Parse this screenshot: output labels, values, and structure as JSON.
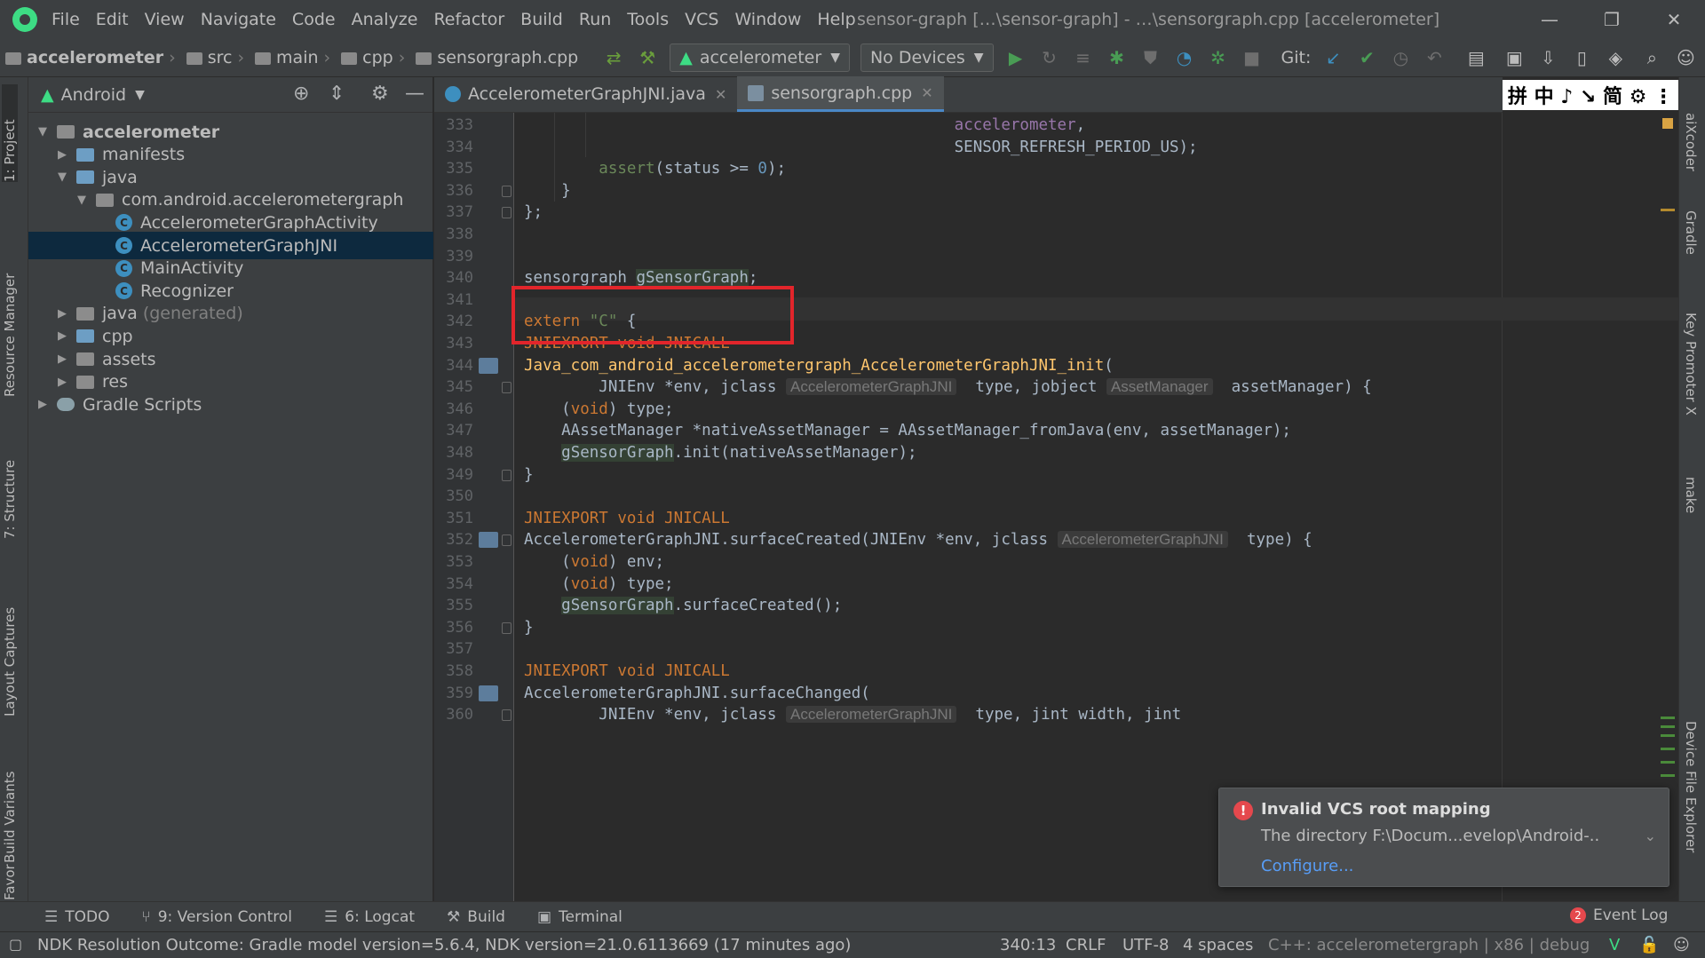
{
  "menubar": {
    "items": [
      "File",
      "Edit",
      "View",
      "Navigate",
      "Code",
      "Analyze",
      "Refactor",
      "Build",
      "Run",
      "Tools",
      "VCS",
      "Window",
      "Help"
    ],
    "title": "sensor-graph […\\sensor-graph] - …\\sensorgraph.cpp [accelerometer]"
  },
  "breadcrumbs": [
    "accelerometer",
    "src",
    "main",
    "cpp",
    "sensorgraph.cpp"
  ],
  "toolbar": {
    "run_config": "accelerometer",
    "device": "No Devices",
    "git_label": "Git:"
  },
  "project": {
    "view_mode": "Android",
    "tree": [
      {
        "label": "accelerometer",
        "depth": 0,
        "expanded": true,
        "kind": "module",
        "bold": true
      },
      {
        "label": "manifests",
        "depth": 1,
        "expanded": false,
        "kind": "folder-blue"
      },
      {
        "label": "java",
        "depth": 1,
        "expanded": true,
        "kind": "folder-blue"
      },
      {
        "label": "com.android.accelerometergraph",
        "depth": 2,
        "expanded": true,
        "kind": "package"
      },
      {
        "label": "AccelerometerGraphActivity",
        "depth": 3,
        "kind": "class"
      },
      {
        "label": "AccelerometerGraphJNI",
        "depth": 3,
        "kind": "class",
        "selected": true
      },
      {
        "label": "MainActivity",
        "depth": 3,
        "kind": "class"
      },
      {
        "label": "Recognizer",
        "depth": 3,
        "kind": "class"
      },
      {
        "label": "java",
        "suffix": "(generated)",
        "depth": 1,
        "expanded": false,
        "kind": "folder-grey"
      },
      {
        "label": "cpp",
        "depth": 1,
        "expanded": false,
        "kind": "folder-blue"
      },
      {
        "label": "assets",
        "depth": 1,
        "expanded": false,
        "kind": "folder-grey"
      },
      {
        "label": "res",
        "depth": 1,
        "expanded": false,
        "kind": "folder-grey"
      },
      {
        "label": "Gradle Scripts",
        "depth": 0,
        "expanded": false,
        "kind": "gradle"
      }
    ]
  },
  "left_tabs": [
    "1: Project",
    "Resource Manager",
    "7: Structure",
    "Layout Captures",
    "Build Variants",
    "Favorites"
  ],
  "right_tabs": [
    "aiXcoder",
    "Gradle",
    "Key Promoter X",
    "make",
    "Device File Explorer"
  ],
  "editor": {
    "tabs": [
      {
        "label": "AccelerometerGraphJNI.java",
        "active": false
      },
      {
        "label": "sensorgraph.cpp",
        "active": true
      }
    ],
    "ime_bar": "拼 中 ♪ ↘ 简 ⚙ ⋮",
    "lines": [
      {
        "no": "333",
        "html": "                                              <span class=\"var\">accelerometer</span>,"
      },
      {
        "no": "334",
        "html": "                                              SENSOR_REFRESH_PERIOD_US);"
      },
      {
        "no": "335",
        "html": "        <span class=\"str\">assert</span>(status &gt;= <span class=\"num\">0</span>);"
      },
      {
        "no": "336",
        "html": "    }"
      },
      {
        "no": "337",
        "html": "};"
      },
      {
        "no": "338",
        "html": ""
      },
      {
        "no": "339",
        "html": ""
      },
      {
        "no": "340",
        "html": "sensorgraph <span class=\"ref\">gSensorGraph</span>;"
      },
      {
        "no": "341",
        "html": ""
      },
      {
        "no": "342",
        "html": "<span class=\"kw\">extern</span> <span class=\"str\">\"C\"</span> {"
      },
      {
        "no": "343",
        "html": "<span class=\"kw\">JNIEXPORT void JNICALL</span>"
      },
      {
        "no": "344",
        "html": "<span class=\"fn\">Java_com_android_accelerometergraph_AccelerometerGraphJNI_init</span>("
      },
      {
        "no": "345",
        "html": "        JNIEnv *env, jclass <span class=\"hint\">AccelerometerGraphJNI</span>  type, jobject <span class=\"hint\">AssetManager</span>  assetManager) {"
      },
      {
        "no": "346",
        "html": "    (<span class=\"kw\">void</span>) type;"
      },
      {
        "no": "347",
        "html": "    AAssetManager *nativeAssetManager = AAssetManager_fromJava(env, assetManager);"
      },
      {
        "no": "348",
        "html": "    <span class=\"ref\">gSensorGraph</span>.init(nativeAssetManager);"
      },
      {
        "no": "349",
        "html": "}"
      },
      {
        "no": "350",
        "html": ""
      },
      {
        "no": "351",
        "html": "<span class=\"kw\">JNIEXPORT void JNICALL</span>"
      },
      {
        "no": "352",
        "html": "AccelerometerGraphJNI.surfaceCreated(JNIEnv *env, jclass <span class=\"hint\">AccelerometerGraphJNI</span>  type) {"
      },
      {
        "no": "353",
        "html": "    (<span class=\"kw\">void</span>) env;"
      },
      {
        "no": "354",
        "html": "    (<span class=\"kw\">void</span>) type;"
      },
      {
        "no": "355",
        "html": "    <span class=\"ref\">gSensorGraph</span>.surfaceCreated();"
      },
      {
        "no": "356",
        "html": "}"
      },
      {
        "no": "357",
        "html": ""
      },
      {
        "no": "358",
        "html": "<span class=\"kw\">JNIEXPORT void JNICALL</span>"
      },
      {
        "no": "359",
        "html": "AccelerometerGraphJNI.surfaceChanged("
      },
      {
        "no": "360",
        "html": "        JNIEnv *env, jclass <span class=\"hint\">AccelerometerGraphJNI</span>  type, jint width, jint"
      }
    ]
  },
  "notification": {
    "title": "Invalid VCS root mapping",
    "body": "The directory F:\\Docum...evelop\\Android-..",
    "link": "Configure..."
  },
  "bottom_tabs": [
    {
      "label": "TODO",
      "icon": "list-icon"
    },
    {
      "label": "9: Version Control",
      "icon": "branch-icon"
    },
    {
      "label": "6: Logcat",
      "icon": "logcat-icon"
    },
    {
      "label": "Build",
      "icon": "hammer-icon"
    },
    {
      "label": "Terminal",
      "icon": "terminal-icon"
    }
  ],
  "event_log": {
    "count": "2",
    "label": "Event Log"
  },
  "status": {
    "message": "NDK Resolution Outcome: Gradle model version=5.6.4, NDK version=21.0.6113669 (17 minutes ago)",
    "position": "340:13",
    "line_sep": "CRLF",
    "encoding": "UTF-8",
    "indent": "4 spaces",
    "context": "C++: accelerometergraph | x86 | debug"
  },
  "colors": {
    "accent": "#4a88c7",
    "highlight_box": "#e2252b",
    "error": "#e5484d",
    "link": "#589df6"
  }
}
